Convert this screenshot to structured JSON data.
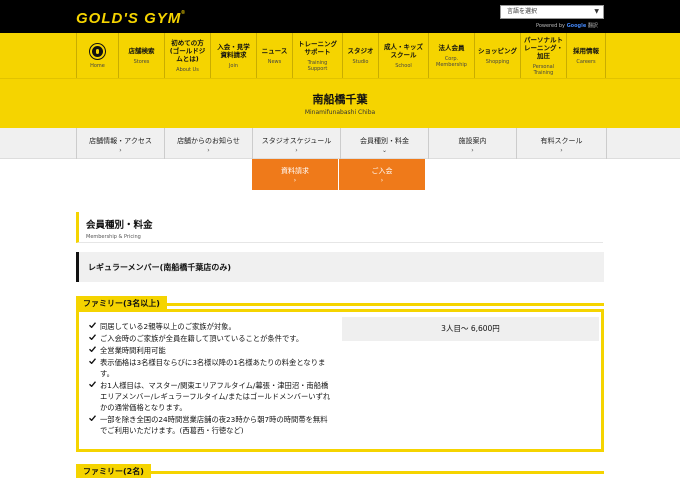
{
  "header": {
    "logo_text": "GOLD'S GYM",
    "logo_mark": "®",
    "language_select": "言語を選択",
    "powered_by": "Powered by",
    "powered_brand": "Google",
    "powered_service": "翻訳"
  },
  "nav": {
    "items": [
      {
        "icon": "golds-gym-emblem-icon",
        "jp": "",
        "en": "Home",
        "width": 42
      },
      {
        "jp": "店舗検索",
        "en": "Stores"
      },
      {
        "jp": "初めての方\n(ゴールドジ\nムとは)",
        "en": "About Us"
      },
      {
        "jp": "入会・見学\n資料請求",
        "en": "Join"
      },
      {
        "jp": "ニュース",
        "en": "News"
      },
      {
        "jp": "トレーニング\nサポート",
        "en": "Training\nSupport"
      },
      {
        "jp": "スタジオ",
        "en": "Studio"
      },
      {
        "jp": "成人・キッズ\nスクール",
        "en": "School"
      },
      {
        "jp": "法人会員",
        "en": "Corp.\nMembership"
      },
      {
        "jp": "ショッピング",
        "en": "Shopping"
      },
      {
        "jp": "パーソナルト\nレーニング・\n加圧",
        "en": "Personal\nTraining"
      },
      {
        "jp": "採用情報",
        "en": "Careers"
      }
    ]
  },
  "club": {
    "name": "南船橋千葉",
    "name_en": "Minamifunabashi Chiba"
  },
  "subnav": {
    "items": [
      "店舗情報・アクセス",
      "店舗からのお知らせ",
      "スタジオスケジュール",
      "会員種別・料金",
      "施設案内",
      "有料スクール"
    ],
    "chevron": "›"
  },
  "actions": {
    "request_docs": "資料請求",
    "join": "ご入会"
  },
  "section": {
    "title": "会員種別・料金",
    "subtitle": "Membership & Pricing"
  },
  "member_type": "レギュラーメンバー(南船橋千葉店のみ)",
  "plans": [
    {
      "label": "ファミリー(3名以上)",
      "conditions": [
        "同居している2親等以上のご家族が対象。",
        "ご入会時のご家族が全員在籍して頂いていることが条件です。",
        "全営業時間利用可能",
        "表示価格は3名様目ならびに3名様以降の1名様あたりの料金となります。",
        "お1人様目は、マスター/関東エリアフルタイム/幕張・津田沼・南船橋エリアメンバー/レギュラーフルタイム/またはゴールドメンバーいずれかの通常価格となります。",
        "一部を除き全国の24時間営業店舗の夜23時から朝7時の時間帯を無料でご利用いただけます。(西葛西・行徳など)"
      ],
      "price": "3人目〜 6,600円"
    },
    {
      "label": "ファミリー(2名)"
    }
  ],
  "colors": {
    "brand_yellow": "#f5d400",
    "accent_orange": "#ef7a1a",
    "black": "#000000"
  }
}
